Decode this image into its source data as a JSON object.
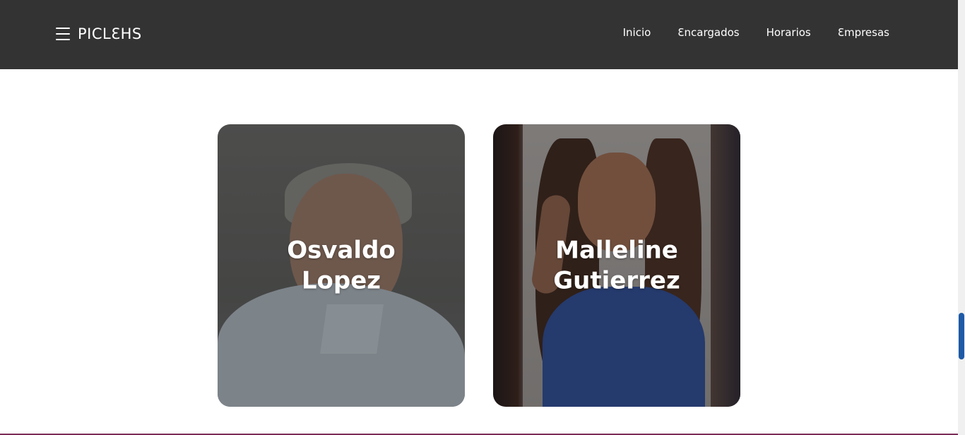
{
  "header": {
    "brand": "PICLƐHS",
    "menu_icon": "hamburger-menu-icon",
    "nav": [
      {
        "label": "Inicio"
      },
      {
        "label": "Ɛncargados"
      },
      {
        "label": "Horarios"
      },
      {
        "label": "Ɛmpresas"
      }
    ]
  },
  "cards": [
    {
      "name": "Osvaldo Lopez"
    },
    {
      "name": "Malleline Gutierrez"
    }
  ],
  "colors": {
    "header_bg": "#333333",
    "scroll_thumb": "#1f5aa6"
  }
}
